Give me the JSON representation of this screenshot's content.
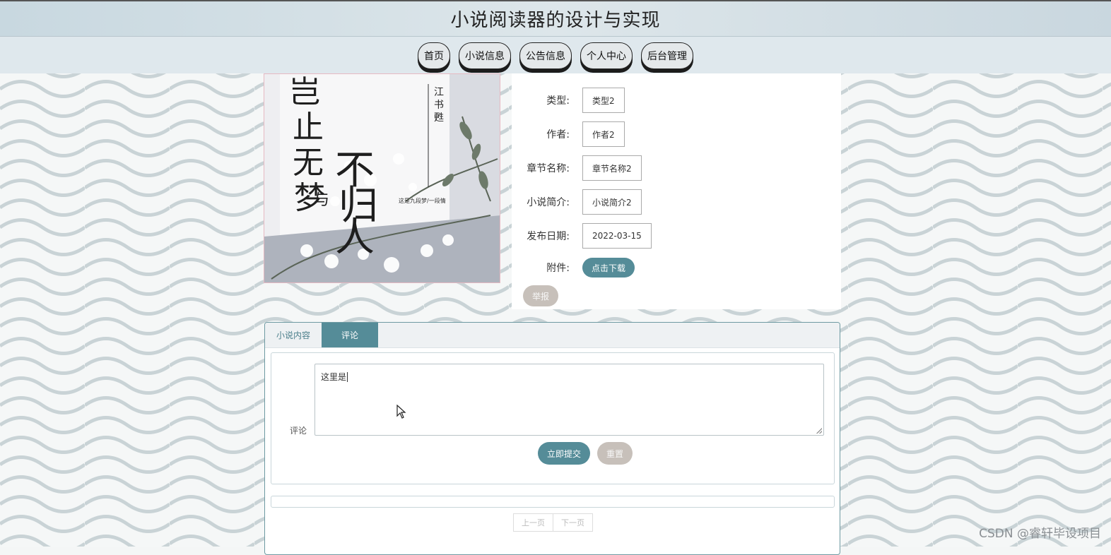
{
  "header": {
    "title": "小说阅读器的设计与实现"
  },
  "nav": {
    "items": [
      "首页",
      "小说信息",
      "公告信息",
      "个人中心",
      "后台管理"
    ]
  },
  "cover": {
    "title_chars": [
      "岂",
      "止",
      "无",
      "梦",
      "与",
      "不",
      "归",
      "人"
    ],
    "author_line": "江书甦",
    "tagline": "这是九段梦 / 一段情"
  },
  "details": {
    "type_label": "类型:",
    "type_value": "类型2",
    "author_label": "作者:",
    "author_value": "作者2",
    "chapter_label": "章节名称:",
    "chapter_value": "章节名称2",
    "intro_label": "小说简介:",
    "intro_value": "小说简介2",
    "date_label": "发布日期:",
    "date_value": "2022-03-15",
    "attach_label": "附件:",
    "download_label": "点击下载",
    "report_label": "举报"
  },
  "tabs": {
    "content_label": "小说内容",
    "comment_label": "评论"
  },
  "comment": {
    "label": "评论",
    "text": "这里是",
    "submit_label": "立即提交",
    "reset_label": "重置"
  },
  "pager": {
    "prev_label": "上一页",
    "next_label": "下一页"
  },
  "watermark": "CSDN @睿轩毕设项目",
  "colors": {
    "accent": "#558c98",
    "secondary_button": "#c7c0ba",
    "header_bg": "#d1dfe6"
  }
}
